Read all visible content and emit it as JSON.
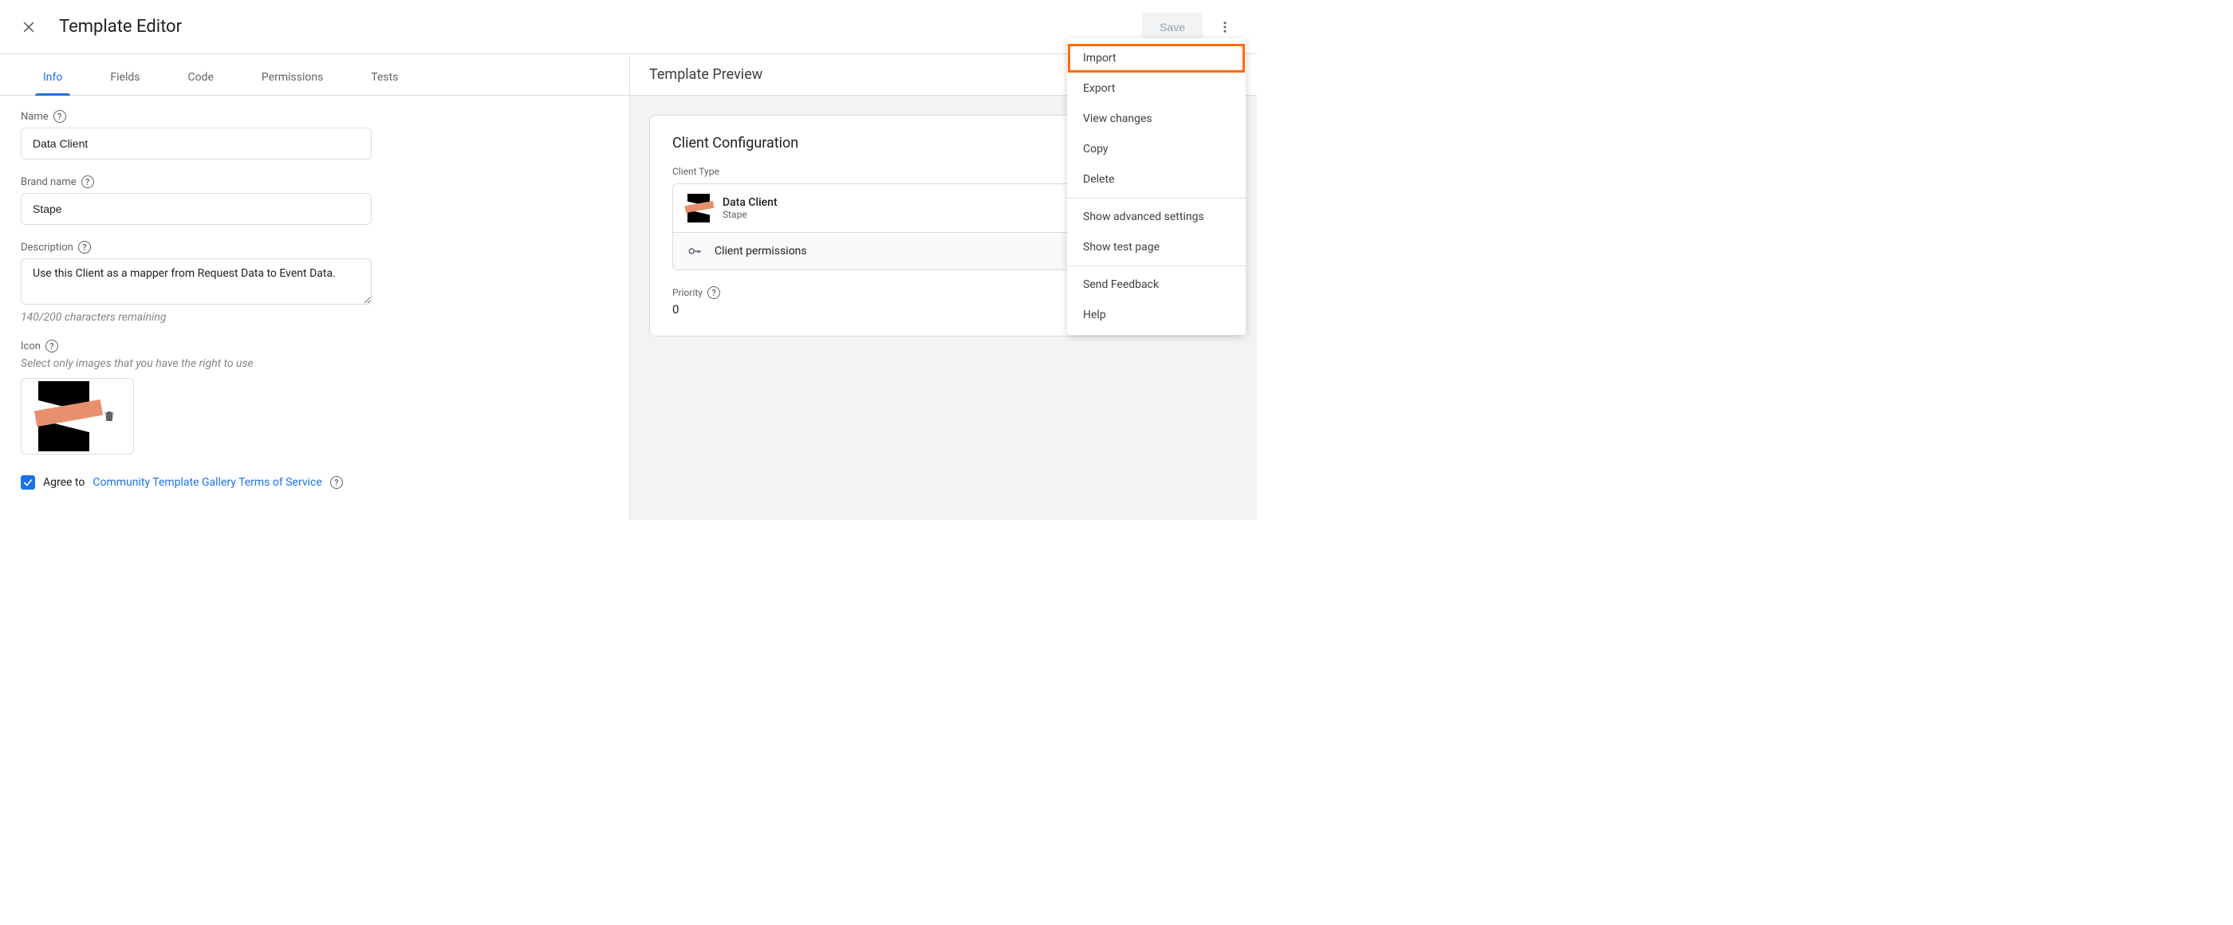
{
  "header": {
    "title": "Template Editor",
    "save_label": "Save"
  },
  "tabs": [
    "Info",
    "Fields",
    "Code",
    "Permissions",
    "Tests"
  ],
  "active_tab_index": 0,
  "info_form": {
    "name_label": "Name",
    "name_value": "Data Client",
    "brand_label": "Brand name",
    "brand_value": "Stape",
    "description_label": "Description",
    "description_value": "Use this Client as a mapper from Request Data to Event Data.",
    "description_helper": "140/200 characters remaining",
    "icon_label": "Icon",
    "icon_helper": "Select only images that you have the right to use",
    "agree_text": "Agree to ",
    "tos_link_text": "Community Template Gallery Terms of Service",
    "agree_checked": true
  },
  "preview": {
    "heading": "Template Preview",
    "card_title": "Client Configuration",
    "client_type_label": "Client Type",
    "client_name": "Data Client",
    "client_subtitle": "Stape",
    "client_permissions_label": "Client permissions",
    "priority_label": "Priority",
    "priority_value": "0"
  },
  "menu": {
    "items": [
      "Import",
      "Export",
      "View changes",
      "Copy",
      "Delete",
      "Show advanced settings",
      "Show test page",
      "Send Feedback",
      "Help"
    ],
    "highlight_index": 0,
    "dividers_after": [
      4,
      6
    ]
  }
}
